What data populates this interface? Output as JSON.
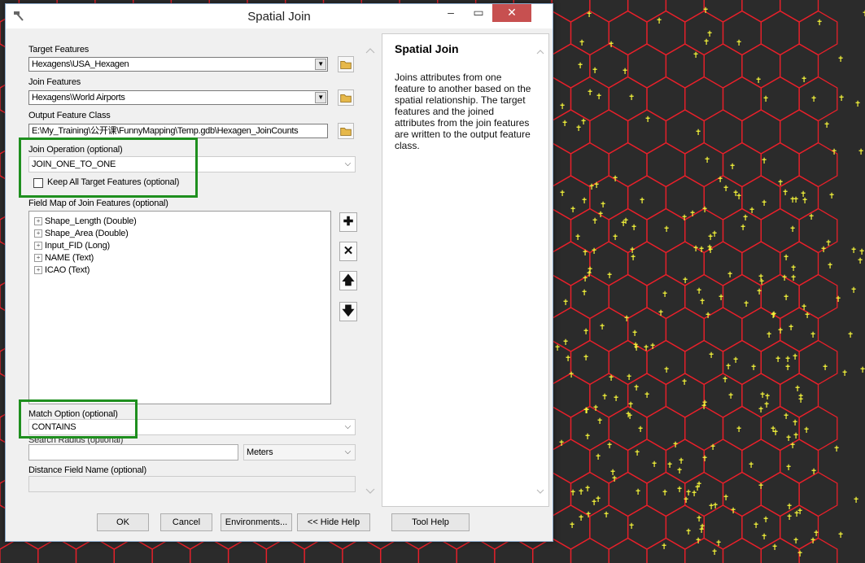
{
  "window": {
    "title": "Spatial Join"
  },
  "form": {
    "target_features_label": "Target Features",
    "target_features_value": "Hexagens\\USA_Hexagen",
    "join_features_label": "Join Features",
    "join_features_value": "Hexagens\\World Airports",
    "output_label": "Output Feature Class",
    "output_value": "E:\\My_Training\\公开课\\FunnyMapping\\Temp.gdb\\Hexagen_JoinCounts",
    "join_op_label": "Join Operation (optional)",
    "join_op_value": "JOIN_ONE_TO_ONE",
    "keep_all_label": "Keep All Target Features (optional)",
    "field_map_label": "Field Map of Join Features (optional)",
    "fields": [
      "Shape_Length (Double)",
      "Shape_Area (Double)",
      "Input_FID (Long)",
      "NAME (Text)",
      "ICAO (Text)"
    ],
    "match_label": "Match Option (optional)",
    "match_value": "CONTAINS",
    "radius_label": "Search Radius (optional)",
    "radius_unit": "Meters",
    "distance_label": "Distance Field Name (optional)"
  },
  "buttons": {
    "ok": "OK",
    "cancel": "Cancel",
    "environments": "Environments...",
    "hide_help": "<< Hide Help",
    "tool_help": "Tool Help"
  },
  "help": {
    "title": "Spatial Join",
    "text": "Joins attributes from one feature to another based on the spatial relationship. The target features and the joined attributes from the join features are written to the output feature class."
  },
  "colors": {
    "hex_outline": "#e8202a",
    "airport": "#f4f43a",
    "map_bg": "#2b2b2b",
    "highlight": "#1e8f1e"
  }
}
